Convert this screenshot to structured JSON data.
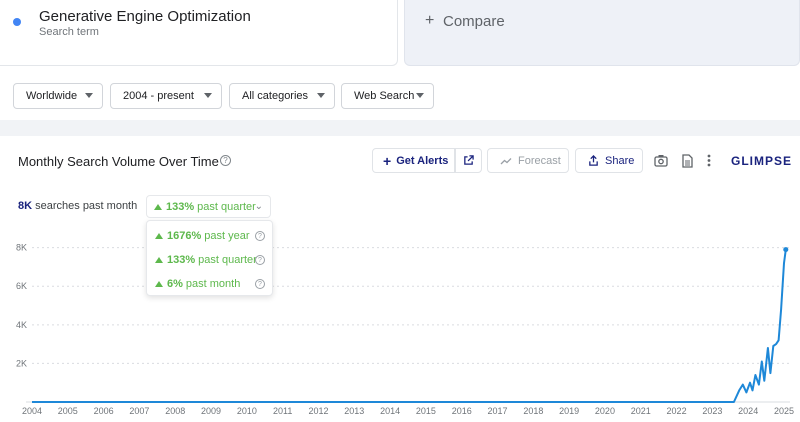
{
  "term": {
    "title": "Generative Engine Optimization",
    "subtitle": "Search term",
    "dot_color": "#4285f4"
  },
  "compare": {
    "plus": "+",
    "label": "Compare"
  },
  "filters": {
    "region": "Worldwide",
    "period": "2004 - present",
    "category": "All categories",
    "source": "Web Search"
  },
  "chart": {
    "title": "Monthly Search Volume Over Time",
    "help": "?",
    "get_alerts": "Get Alerts",
    "forecast": "Forecast",
    "share": "Share",
    "brand": "GLIMPSE",
    "stat_value": "8K",
    "stat_text": "searches past month",
    "quarter_value": "133%",
    "quarter_text": "past quarter",
    "chevron": "⌄",
    "dropdown": [
      {
        "value": "1676%",
        "text": "past year"
      },
      {
        "value": "133%",
        "text": "past quarter"
      },
      {
        "value": "6%",
        "text": "past month"
      }
    ]
  },
  "colors": {
    "accent": "#1a237e",
    "line": "#1e88d8",
    "positive": "#5db84c"
  },
  "chart_data": {
    "type": "line",
    "y_ticks": [
      "2K",
      "4K",
      "6K",
      "8K"
    ],
    "y_tick_values": [
      2000,
      4000,
      6000,
      8000
    ],
    "x_ticks": [
      "2004",
      "2005",
      "2006",
      "2007",
      "2008",
      "2009",
      "2010",
      "2011",
      "2012",
      "2013",
      "2014",
      "2015",
      "2016",
      "2017",
      "2018",
      "2019",
      "2020",
      "2021",
      "2022",
      "2023",
      "2024",
      "2025"
    ],
    "ylim": [
      0,
      8500
    ],
    "xlim": [
      2004,
      2025
    ],
    "grid": true,
    "series": [
      {
        "values_x": [
          2004,
          2023.6,
          2023.75,
          2023.85,
          2023.95,
          2024.05,
          2024.12,
          2024.2,
          2024.3,
          2024.38,
          2024.45,
          2024.55,
          2024.62,
          2024.7,
          2024.78,
          2024.85,
          2024.92,
          2025.0,
          2025.05
        ],
        "values_y": [
          0,
          0,
          600,
          900,
          500,
          1000,
          600,
          1400,
          900,
          2100,
          1100,
          2800,
          1500,
          2900,
          3000,
          3200,
          4800,
          7200,
          7900
        ]
      }
    ]
  }
}
